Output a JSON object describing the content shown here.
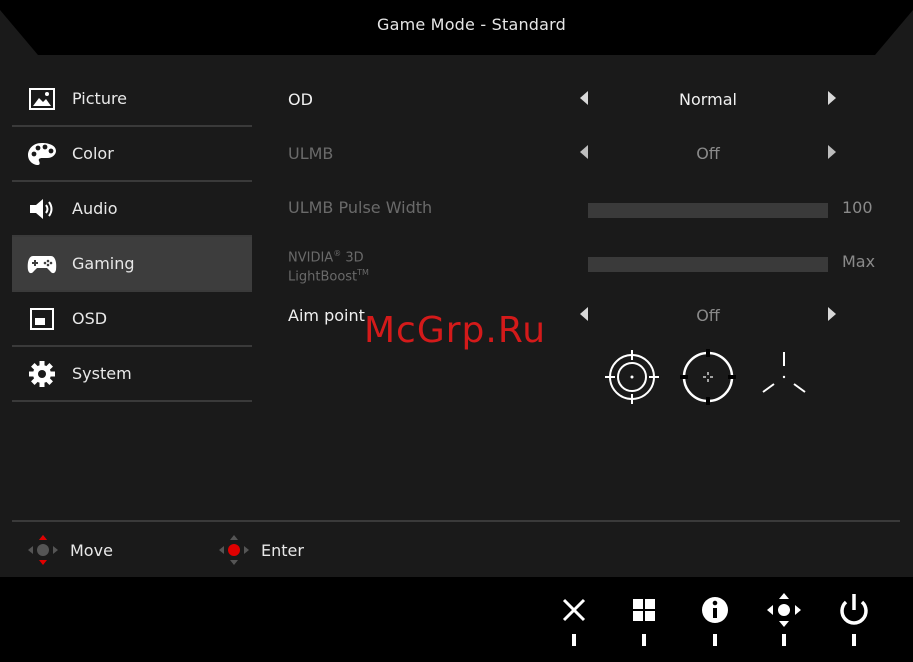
{
  "header": {
    "title": "Game Mode - Standard"
  },
  "sidebar": {
    "items": [
      {
        "label": "Picture",
        "icon": "picture-icon"
      },
      {
        "label": "Color",
        "icon": "palette-icon"
      },
      {
        "label": "Audio",
        "icon": "speaker-icon"
      },
      {
        "label": "Gaming",
        "icon": "gamepad-icon",
        "active": true
      },
      {
        "label": "OSD",
        "icon": "osd-window-icon"
      },
      {
        "label": "System",
        "icon": "gear-icon"
      }
    ]
  },
  "settings": {
    "od": {
      "label": "OD",
      "value": "Normal"
    },
    "ulmb": {
      "label": "ULMB",
      "value": "Off"
    },
    "ulmb_pulse_width": {
      "label": "ULMB Pulse Width",
      "value": "100"
    },
    "nvidia_3d": {
      "label_line1": "NVIDIA",
      "reg": "®",
      "label_3d": " 3D",
      "label_line2": "LightBoost",
      "tm": "TM",
      "value": "Max"
    },
    "aim_point": {
      "label": "Aim point",
      "value": "Off"
    }
  },
  "aim_point_styles": [
    "crosshair-circle-icon",
    "crosshair-dot-icon",
    "crosshair-tri-icon"
  ],
  "watermark": "McGrp.Ru",
  "legend": {
    "move": "Move",
    "enter": "Enter"
  },
  "keys": [
    "close-icon",
    "grid-menu-icon",
    "info-icon",
    "navigation-icon",
    "power-icon"
  ],
  "colors": {
    "accent": "#e00000",
    "active_bg": "#3d3d3d",
    "frame_bg": "#1a1a1a"
  }
}
